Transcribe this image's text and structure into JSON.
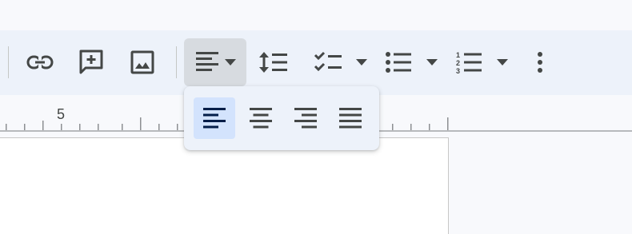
{
  "toolbar": {
    "icons": [
      "insert-link-icon",
      "add-comment-icon",
      "insert-image-icon",
      "align-left-icon",
      "line-spacing-icon",
      "checklist-icon",
      "bulleted-list-icon",
      "numbered-list-icon",
      "more-options-icon"
    ]
  },
  "ruler": {
    "label": "5"
  },
  "align_menu": {
    "options": [
      "left",
      "center",
      "right",
      "justify"
    ],
    "selected": "left"
  },
  "colors": {
    "toolbar_bg": "#edf2fa",
    "icon": "#444746",
    "selected_bg": "#d3e3fd",
    "selected_icon": "#041e49"
  }
}
